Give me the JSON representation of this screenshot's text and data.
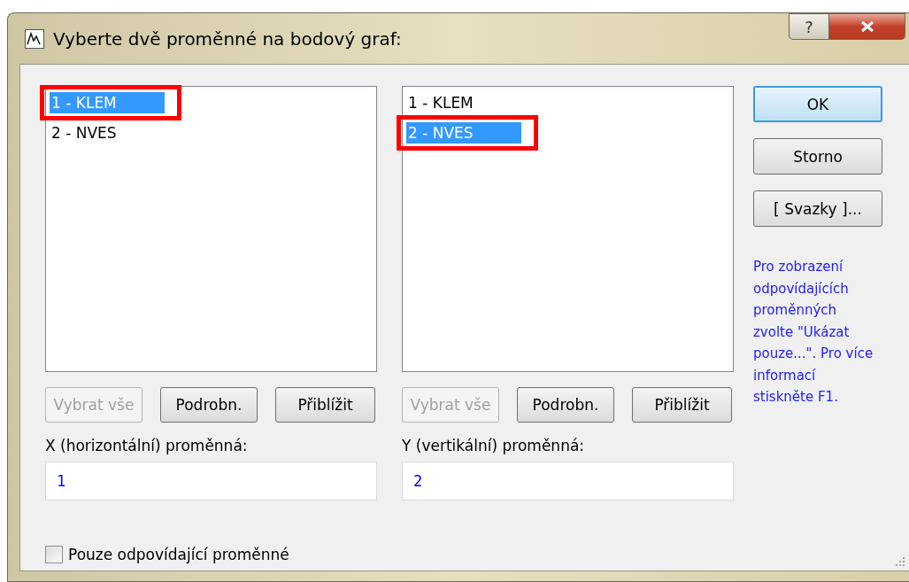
{
  "window": {
    "title": "Vyberte dvě proměnné na bodový graf:",
    "help_button": "?"
  },
  "lists": [
    {
      "items": [
        {
          "label": "1 - KLEM",
          "selected": true,
          "highlighted": true
        },
        {
          "label": "2 - NVES",
          "selected": false,
          "highlighted": false
        }
      ],
      "buttons": [
        {
          "label": "Vybrat vše",
          "disabled": true
        },
        {
          "label": "Podrobn.",
          "disabled": false
        },
        {
          "label": "Přiblížit",
          "disabled": false
        }
      ],
      "field_label": "X (horizontální) proměnná:",
      "field_value": "1"
    },
    {
      "items": [
        {
          "label": "1 - KLEM",
          "selected": false,
          "highlighted": false
        },
        {
          "label": "2 - NVES",
          "selected": true,
          "highlighted": true
        }
      ],
      "buttons": [
        {
          "label": "Vybrat vše",
          "disabled": true
        },
        {
          "label": "Podrobn.",
          "disabled": false
        },
        {
          "label": "Přiblížit",
          "disabled": false
        }
      ],
      "field_label": "Y (vertikální) proměnná:",
      "field_value": "2"
    }
  ],
  "actions": [
    {
      "label": "OK",
      "default": true
    },
    {
      "label": "Storno",
      "default": false
    },
    {
      "label": "[ Svazky ]...",
      "default": false
    }
  ],
  "help_text": "Pro zobrazení odpovídajících proměnných zvolte \"Ukázat pouze...\". Pro více informací stiskněte F1.",
  "checkbox": {
    "label": "Pouze odpovídající proměnné",
    "checked": false
  }
}
